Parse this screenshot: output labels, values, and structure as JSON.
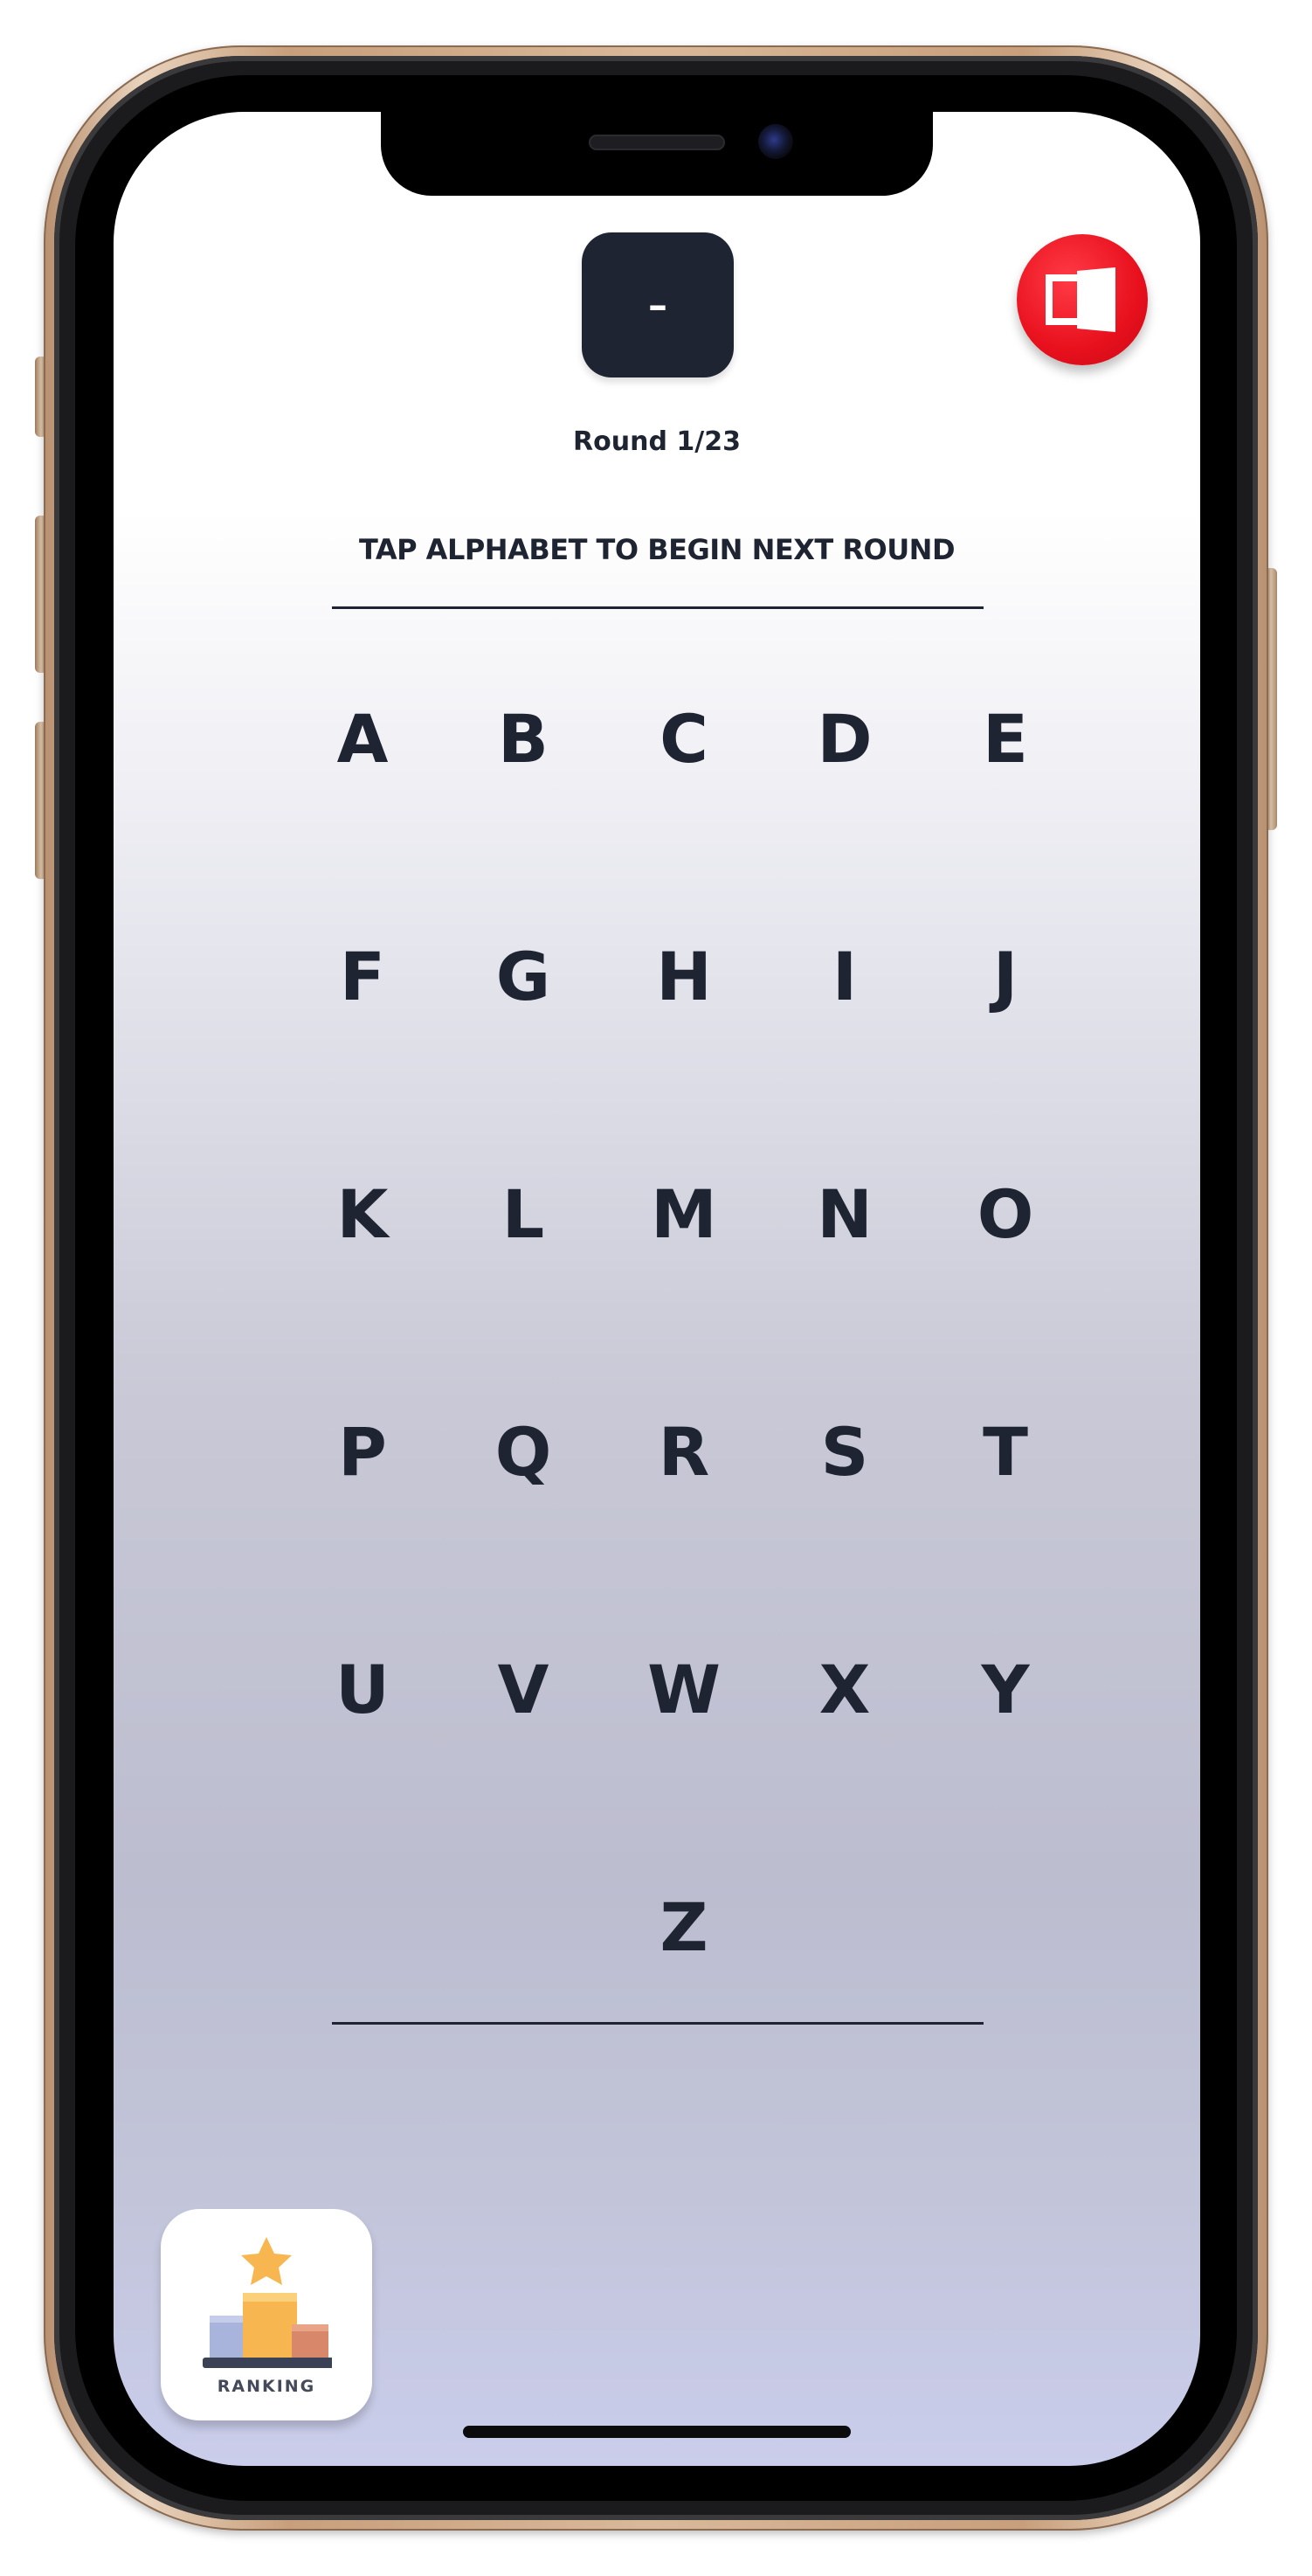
{
  "header": {
    "timer_text": "–",
    "exit_icon": "exit-door-icon"
  },
  "round": {
    "label": "Round 1/23"
  },
  "instruction": "TAP ALPHABET TO BEGIN NEXT ROUND",
  "alphabet": [
    "A",
    "B",
    "C",
    "D",
    "E",
    "F",
    "G",
    "H",
    "I",
    "J",
    "K",
    "L",
    "M",
    "N",
    "O",
    "P",
    "Q",
    "R",
    "S",
    "T",
    "U",
    "V",
    "W",
    "X",
    "Y",
    "Z"
  ],
  "ranking": {
    "label": "RANKING",
    "icon": "podium-star-icon"
  },
  "colors": {
    "primary_dark": "#1f2433",
    "exit_red": "#e8101d",
    "podium_gold": "#f7b64f",
    "podium_blue": "#a8b4dc",
    "podium_copper": "#d9876a"
  }
}
